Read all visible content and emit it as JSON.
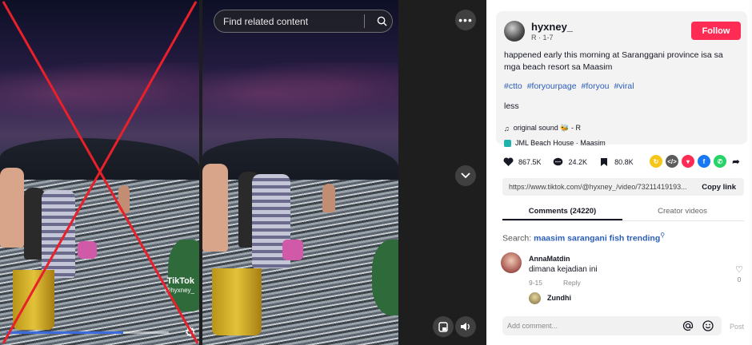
{
  "left_thumbnail": {
    "watermark_brand": "TikTok",
    "watermark_handle": "@hyxney_",
    "progress": 0.72
  },
  "player": {
    "search": {
      "placeholder": "Find related content"
    },
    "icons": [
      "more-icon",
      "chevron-down-icon",
      "pip-icon",
      "volume-icon",
      "search-icon"
    ]
  },
  "author": {
    "username": "hyxney_",
    "subtitle": "R · 1-7",
    "follow_label": "Follow"
  },
  "post": {
    "description": "happened early this morning at Saranggani province isa sa mga beach resort sa Maasim",
    "hashtags": [
      "#ctto",
      "#foryourpage",
      "#foryou",
      "#viral"
    ],
    "less_label": "less",
    "sound": "original sound 🐝 - R",
    "location": "JML Beach House · Maasim"
  },
  "stats": {
    "likes": "867.5K",
    "comments": "24.2K",
    "saves": "80.8K"
  },
  "share": {
    "url": "https://www.tiktok.com/@hyxney_/video/73211419193...",
    "copy_label": "Copy link",
    "colors": {
      "repost": "#f5c518",
      "embed": "#5c5c5c",
      "send": "#fe2c55",
      "facebook": "#1877f2",
      "whatsapp": "#25d366"
    }
  },
  "tabs": {
    "comments": "Comments (24220)",
    "creator_videos": "Creator videos"
  },
  "related_search": {
    "prefix": "Search:",
    "query": "maasim sarangani fish trending"
  },
  "comments": [
    {
      "name": "AnnaMatdin",
      "text": "dimana kejadian ini",
      "date": "9-15",
      "reply_label": "Reply",
      "likes": "0"
    }
  ],
  "reply_preview": {
    "name": "Zundhi"
  },
  "composer": {
    "placeholder": "Add comment...",
    "post_label": "Post"
  },
  "accent": "#fe2c55"
}
